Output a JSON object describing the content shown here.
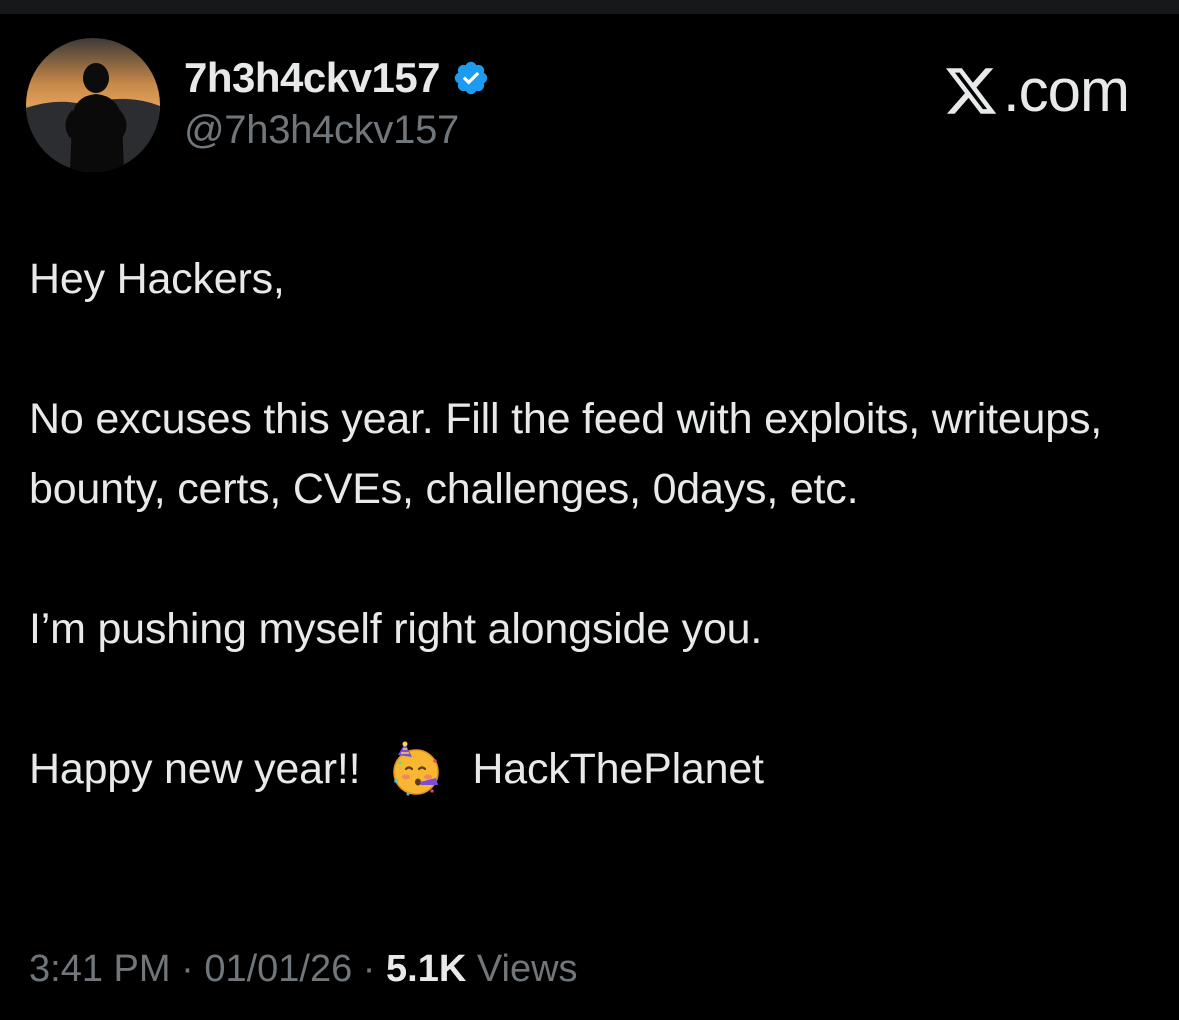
{
  "author": {
    "display_name": "7h3h4ckv157",
    "handle": "@7h3h4ckv157",
    "verified_icon": "verified-badge-icon",
    "avatar": "profile-photo"
  },
  "brand": {
    "logo_text": ".com",
    "logo_icon": "x-logo-icon"
  },
  "tweet": {
    "line_1": "Hey Hackers,",
    "line_2": "No excuses this year. Fill the feed with exploits, writeups, bounty, certs, CVEs, challenges, 0days, etc.",
    "line_3": "I’m pushing myself right alongside you.",
    "line_4_prefix": "Happy new year!!",
    "line_4_emoji": "partying-face-emoji",
    "line_4_suffix": "HackThePlanet"
  },
  "meta": {
    "time": "3:41 PM",
    "sep_1": " · ",
    "date": "01/01/26",
    "sep_2": " · ",
    "views_count": "5.1K",
    "views_label": " Views"
  },
  "colors": {
    "background": "#000000",
    "text_primary": "#e7e9ea",
    "text_secondary": "#71767b",
    "verified_blue": "#1d9bf0"
  }
}
